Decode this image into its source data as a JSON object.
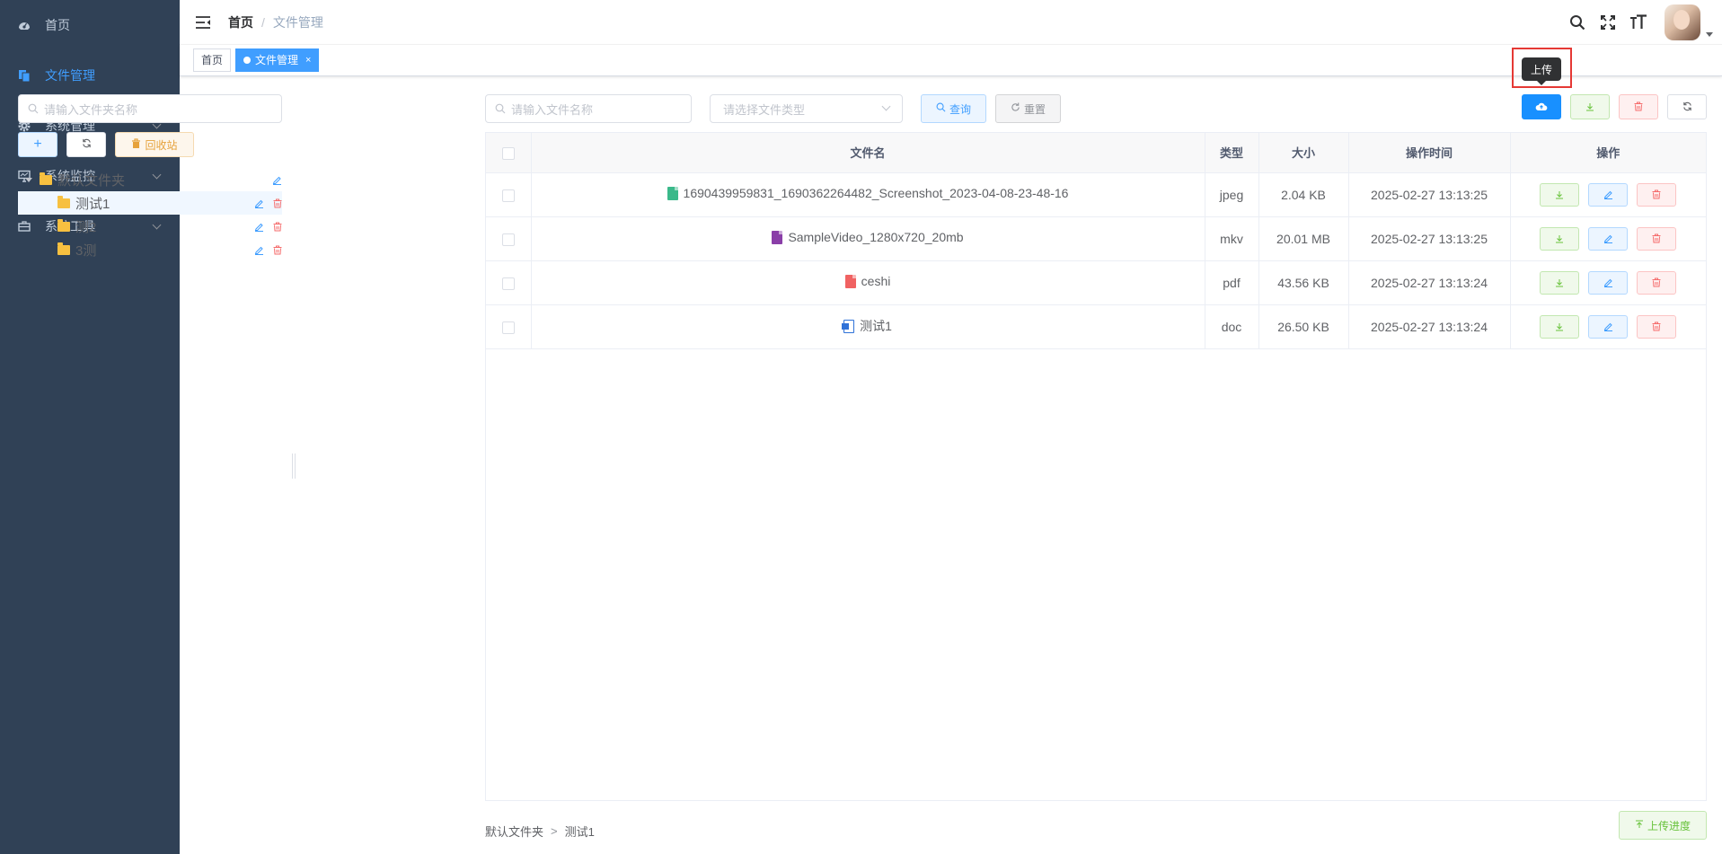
{
  "sidebar": {
    "items": [
      {
        "label": "首页",
        "icon": "dashboard-icon"
      },
      {
        "label": "文件管理",
        "icon": "file-copy-icon",
        "active": true
      },
      {
        "label": "系统管理",
        "icon": "gear-icon",
        "has_children": true
      },
      {
        "label": "系统监控",
        "icon": "monitor-icon",
        "has_children": true
      },
      {
        "label": "系统工具",
        "icon": "toolbox-icon",
        "has_children": true
      }
    ]
  },
  "navbar": {
    "breadcrumb_home": "首页",
    "breadcrumb_separator": "/",
    "breadcrumb_current": "文件管理",
    "icons": [
      "search-icon",
      "fullscreen-icon",
      "font-size-icon"
    ]
  },
  "tags": {
    "home": "首页",
    "active": "文件管理",
    "close": "×"
  },
  "folders": {
    "search_placeholder": "请输入文件夹名称",
    "recycle_label": "回收站",
    "root": "默认文件夹",
    "children": [
      "测试1",
      "测2",
      "3测"
    ],
    "selected": "测试1"
  },
  "files": {
    "search_placeholder": "请输入文件名称",
    "type_placeholder": "请选择文件类型",
    "query_label": "查询",
    "reset_label": "重置",
    "columns": [
      "文件名",
      "类型",
      "大小",
      "操作时间",
      "操作"
    ],
    "rows": [
      {
        "name": "1690439959831_1690362264482_Screenshot_2023-04-08-23-48-16",
        "type": "jpeg",
        "size": "2.04 KB",
        "time": "2025-02-27 13:13:25",
        "icon": "image-file-icon"
      },
      {
        "name": "SampleVideo_1280x720_20mb",
        "type": "mkv",
        "size": "20.01 MB",
        "time": "2025-02-27 13:13:25",
        "icon": "video-file-icon"
      },
      {
        "name": "ceshi",
        "type": "pdf",
        "size": "43.56 KB",
        "time": "2025-02-27 13:13:24",
        "icon": "pdf-file-icon"
      },
      {
        "name": "测试1",
        "type": "doc",
        "size": "26.50 KB",
        "time": "2025-02-27 13:13:24",
        "icon": "word-file-icon"
      }
    ]
  },
  "tooltip": "上传",
  "footer": {
    "path_root": "默认文件夹",
    "path_sep": ">",
    "path_current": "测试1",
    "progress_label": "上传进度"
  },
  "colors": {
    "sidebar_bg": "#304156",
    "primary": "#409eff",
    "upload_btn": "#1890ff",
    "highlight": "#e53935"
  }
}
